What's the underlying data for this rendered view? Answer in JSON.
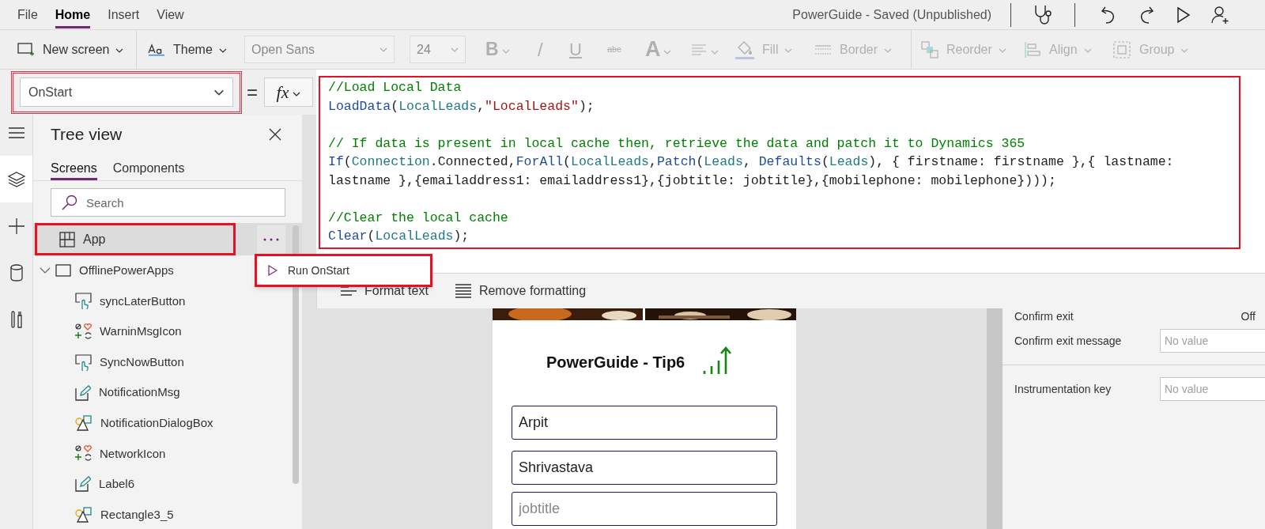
{
  "menu_tabs": [
    {
      "label": "File",
      "selected": false
    },
    {
      "label": "Home",
      "selected": true
    },
    {
      "label": "Insert",
      "selected": false
    },
    {
      "label": "View",
      "selected": false
    }
  ],
  "app_status": "PowerGuide - Saved (Unpublished)",
  "toolbar": {
    "new_screen": {
      "label": "New screen",
      "disabled": false
    },
    "theme": {
      "label": "Theme",
      "disabled": false
    },
    "font": {
      "value": "Open Sans",
      "disabled": true
    },
    "font_size": {
      "value": "24",
      "disabled": true
    },
    "bold": {
      "label": "B",
      "disabled": true
    },
    "italic": {
      "label": "/",
      "disabled": true
    },
    "underline": {
      "label": "U",
      "disabled": true
    },
    "strikethrough": {
      "label": "abc",
      "disabled": true
    },
    "font_color": {
      "label": "A",
      "disabled": true
    },
    "text_align": {
      "disabled": true
    },
    "fill": {
      "label": "Fill",
      "disabled": true
    },
    "border": {
      "label": "Border",
      "disabled": true
    },
    "reorder": {
      "label": "Reorder",
      "disabled": true
    },
    "align": {
      "label": "Align",
      "disabled": true
    },
    "group": {
      "label": "Group",
      "disabled": true
    }
  },
  "formula_bar": {
    "property": {
      "value": "OnStart",
      "highlighted": true
    },
    "equals": "=",
    "fx": "fx"
  },
  "formula": {
    "highlighted": true,
    "blocks": [
      {
        "lines": [
          [
            {
              "kind": "comment",
              "text": "//Load Local Data"
            }
          ],
          [
            {
              "kind": "function",
              "text": "LoadData"
            },
            {
              "kind": "plain",
              "text": "("
            },
            {
              "kind": "identifier",
              "text": "LocalLeads"
            },
            {
              "kind": "plain",
              "text": ","
            },
            {
              "kind": "string",
              "text": "\"LocalLeads\""
            },
            {
              "kind": "plain",
              "text": ");"
            }
          ]
        ]
      },
      {
        "lines": [
          [
            {
              "kind": "comment",
              "text": "// If data is present in local cache then, retrieve the data and patch it to Dynamics 365"
            }
          ],
          [
            {
              "kind": "function",
              "text": "If"
            },
            {
              "kind": "plain",
              "text": "("
            },
            {
              "kind": "identifier",
              "text": "Connection"
            },
            {
              "kind": "plain",
              "text": ".Connected,"
            },
            {
              "kind": "function",
              "text": "ForAll"
            },
            {
              "kind": "plain",
              "text": "("
            },
            {
              "kind": "identifier",
              "text": "LocalLeads"
            },
            {
              "kind": "plain",
              "text": ","
            },
            {
              "kind": "function",
              "text": "Patch"
            },
            {
              "kind": "plain",
              "text": "("
            },
            {
              "kind": "identifier",
              "text": "Leads"
            },
            {
              "kind": "plain",
              "text": ", "
            },
            {
              "kind": "function",
              "text": "Defaults"
            },
            {
              "kind": "plain",
              "text": "("
            },
            {
              "kind": "identifier",
              "text": "Leads"
            },
            {
              "kind": "plain",
              "text": "), { firstname: firstname },{ lastname:"
            }
          ],
          [
            {
              "kind": "plain",
              "text": "lastname },{emailaddress1: emailaddress1},{jobtitle: jobtitle},{mobilephone: mobilephone})));"
            }
          ]
        ]
      },
      {
        "lines": [
          [
            {
              "kind": "comment",
              "text": "//Clear the local cache"
            }
          ],
          [
            {
              "kind": "function",
              "text": "Clear"
            },
            {
              "kind": "plain",
              "text": "("
            },
            {
              "kind": "identifier",
              "text": "LocalLeads"
            },
            {
              "kind": "plain",
              "text": ");"
            }
          ]
        ]
      }
    ]
  },
  "format_bar": [
    {
      "kind": "format",
      "label": "Format text"
    },
    {
      "kind": "remove",
      "label": "Remove formatting"
    }
  ],
  "rail": [
    {
      "kind": "menu",
      "selected": false
    },
    {
      "kind": "layers",
      "selected": true
    },
    {
      "kind": "insert",
      "selected": false
    },
    {
      "kind": "data",
      "selected": false
    },
    {
      "kind": "tools",
      "selected": false
    }
  ],
  "tree_view": {
    "title": "Tree view",
    "tabs": [
      {
        "label": "Screens",
        "selected": true
      },
      {
        "label": "Components",
        "selected": false
      }
    ],
    "search": {
      "placeholder": "Search"
    },
    "items": [
      {
        "kind": "app",
        "label": "App",
        "selected": true,
        "highlighted": true
      },
      {
        "kind": "screen",
        "label": "OfflinePowerApps",
        "selected": false,
        "expanded": true,
        "children": [
          {
            "kind": "button",
            "label": "syncLaterButton",
            "selected": false
          },
          {
            "kind": "icon",
            "label": "WarninMsgIcon",
            "selected": false
          },
          {
            "kind": "button",
            "label": "SyncNowButton",
            "selected": false
          },
          {
            "kind": "label",
            "label": "NotificationMsg",
            "selected": false
          },
          {
            "kind": "shape",
            "label": "NotificationDialogBox",
            "selected": false
          },
          {
            "kind": "icon",
            "label": "NetworkIcon",
            "selected": false
          },
          {
            "kind": "label",
            "label": "Label6",
            "selected": false
          },
          {
            "kind": "shape",
            "label": "Rectangle3_5",
            "selected": false
          }
        ]
      }
    ]
  },
  "context_menu": {
    "highlighted": true,
    "items": [
      {
        "label": "Run OnStart"
      }
    ]
  },
  "app_preview": {
    "title": "PowerGuide - Tip6",
    "fields": [
      {
        "value": "Arpit"
      },
      {
        "value": "Shrivastava"
      },
      {
        "placeholder": "jobtitle"
      }
    ]
  },
  "properties": [
    {
      "kind": "toggle",
      "label": "Confirm exit",
      "value": "Off"
    },
    {
      "kind": "text",
      "label": "Confirm exit message",
      "placeholder": "No value"
    },
    {
      "kind": "text",
      "label": "Instrumentation key",
      "placeholder": "No value"
    }
  ]
}
